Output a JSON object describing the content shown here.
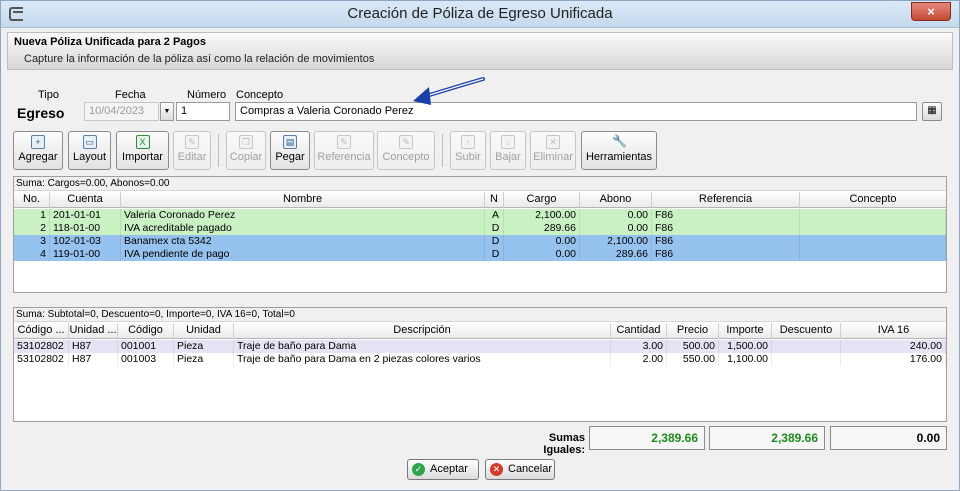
{
  "window": {
    "title": "Creación de Póliza de Egreso Unificada",
    "close_label": "×"
  },
  "header": {
    "title": "Nueva Póliza Unificada para 2 Pagos",
    "subtitle": "Capture la información de la póliza así como la relación de movimientos"
  },
  "form": {
    "tipo_label": "Tipo",
    "tipo_value": "Egreso",
    "fecha_label": "Fecha",
    "fecha_value": "10/04/2023",
    "numero_label": "Número",
    "numero_value": "1",
    "concepto_label": "Concepto",
    "concepto_value": "Compras a  Valeria Coronado Perez"
  },
  "toolbar": {
    "agregar": "Agregar",
    "layout": "Layout",
    "importar": "Importar",
    "editar": "Editar",
    "copiar": "Copiar",
    "pegar": "Pegar",
    "referencia": "Referencia",
    "concepto": "Concepto",
    "subir": "Subir",
    "bajar": "Bajar",
    "eliminar": "Eliminar",
    "herramientas": "Herramientas"
  },
  "movimientos": {
    "summary": "Suma: Cargos=0.00, Abonos=0.00",
    "columns": [
      "No.",
      "Cuenta",
      "Nombre",
      "N",
      "Cargo",
      "Abono",
      "Referencia",
      "Concepto"
    ],
    "rows": [
      {
        "no": "1",
        "cuenta": "201-01-01",
        "nombre": "Valeria Coronado Perez",
        "n": "A",
        "cargo": "2,100.00",
        "abono": "0.00",
        "ref": "F86",
        "concepto": ""
      },
      {
        "no": "2",
        "cuenta": "118-01-00",
        "nombre": "IVA acreditable pagado",
        "n": "D",
        "cargo": "289.66",
        "abono": "0.00",
        "ref": "F86",
        "concepto": ""
      },
      {
        "no": "3",
        "cuenta": "102-01-03",
        "nombre": "Banamex cta 5342",
        "n": "D",
        "cargo": "0.00",
        "abono": "2,100.00",
        "ref": "F86",
        "concepto": ""
      },
      {
        "no": "4",
        "cuenta": "119-01-00",
        "nombre": "IVA pendiente de pago",
        "n": "D",
        "cargo": "0.00",
        "abono": "289.66",
        "ref": "F86",
        "concepto": ""
      }
    ]
  },
  "conceptos": {
    "summary": "Suma: Subtotal=0, Descuento=0, Importe=0, IVA 16=0, Total=0",
    "columns": [
      "Código ...",
      "Unidad ...",
      "Código",
      "Unidad",
      "Descripción",
      "Cantidad",
      "Precio",
      "Importe",
      "Descuento",
      "IVA 16"
    ],
    "rows": [
      {
        "codsat": "53102802",
        "unisat": "H87",
        "codigo": "001001",
        "unidad": "Pieza",
        "desc": "Traje de baño para Dama",
        "cantidad": "3.00",
        "precio": "500.00",
        "importe": "1,500.00",
        "descuento": "",
        "iva": "240.00"
      },
      {
        "codsat": "53102802",
        "unisat": "H87",
        "codigo": "001003",
        "unidad": "Pieza",
        "desc": "Traje de baño para Dama en 2 piezas colores varios",
        "cantidad": "2.00",
        "precio": "550.00",
        "importe": "1,100.00",
        "descuento": "",
        "iva": "176.00"
      }
    ]
  },
  "totals": {
    "label": "Sumas Iguales:",
    "cargos": "2,389.66",
    "abonos": "2,389.66",
    "diferencia": "0.00"
  },
  "buttons": {
    "aceptar": "Aceptar",
    "cancelar": "Cancelar"
  },
  "colors": {
    "row_green": "#c9f1c4",
    "row_blue": "#96c2ef",
    "total_green": "#1d8a1d"
  }
}
